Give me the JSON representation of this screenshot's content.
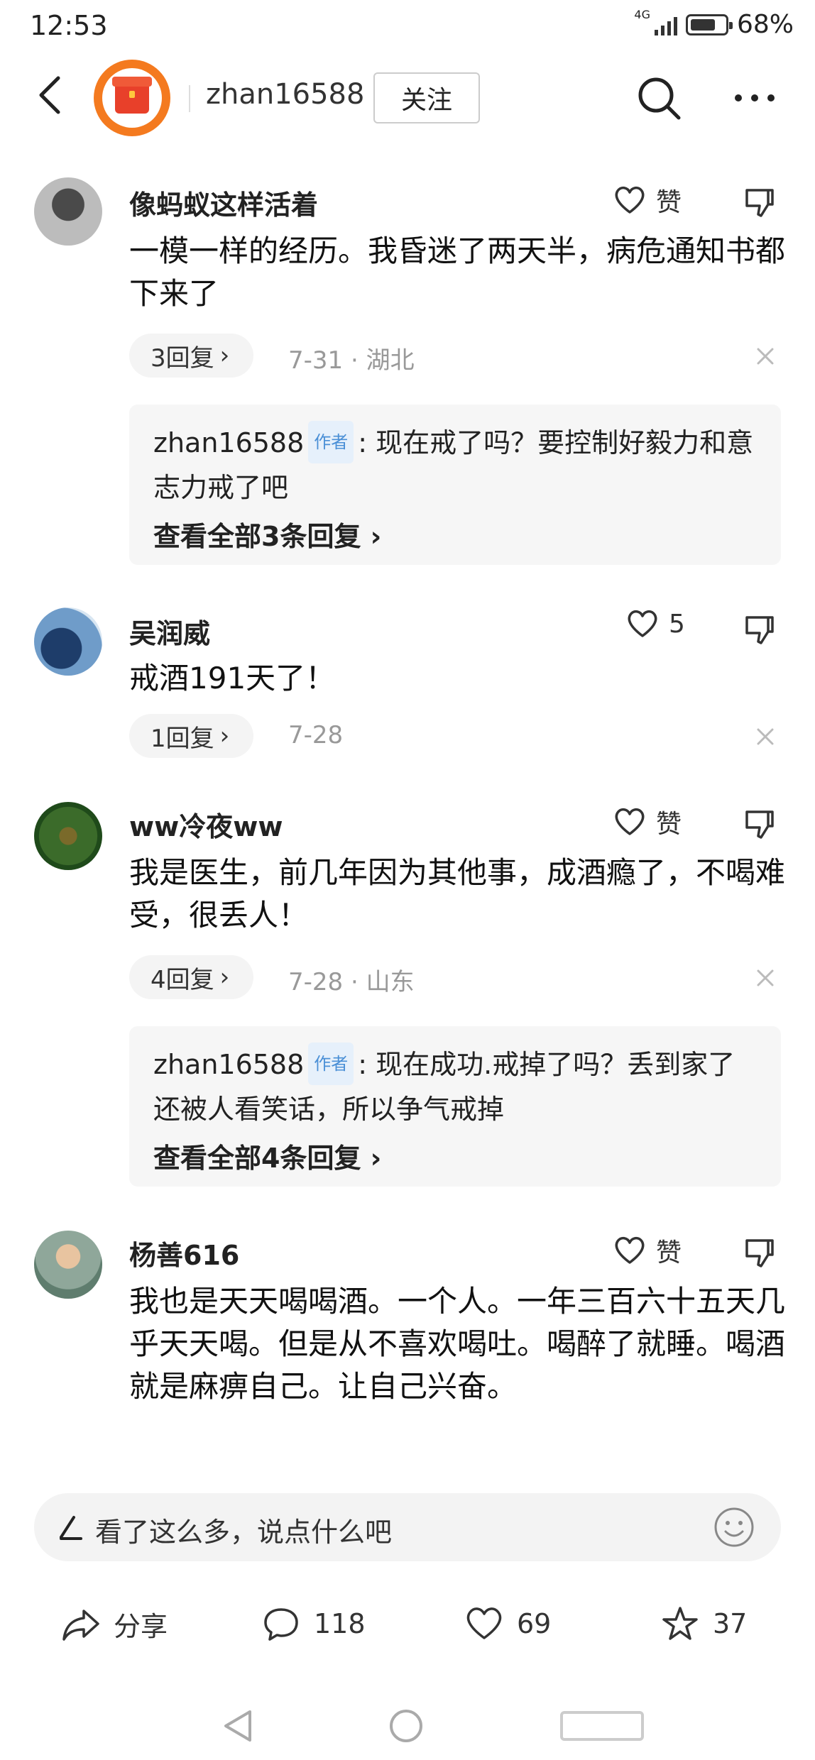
{
  "status_bar": {
    "time": "12:53",
    "network": "4G",
    "battery": "68%"
  },
  "header": {
    "username": "zhan16588",
    "follow_label": "关注"
  },
  "comments": [
    {
      "name": "像蚂蚁这样活着",
      "like_label": "赞",
      "text": "一模一样的经历。我昏迷了两天半，病危通知书都下来了",
      "reply_count": "3回复",
      "meta": "7-31 · 湖北",
      "sub_reply": {
        "author": "zhan16588",
        "author_tag": "作者",
        "text": ": 现在戒了吗？要控制好毅力和意志力戒了吧",
        "view_all": "查看全部3条回复"
      }
    },
    {
      "name": "吴润威",
      "like_label": "5",
      "text": "戒酒191天了！",
      "reply_count": "1回复",
      "meta": "7-28"
    },
    {
      "name": "ww冷夜ww",
      "like_label": "赞",
      "text": "我是医生，前几年因为其他事，成酒瘾了，不喝难受，很丢人！",
      "reply_count": "4回复",
      "meta": "7-28 · 山东",
      "sub_reply": {
        "author": "zhan16588",
        "author_tag": "作者",
        "text": ": 现在成功.戒掉了吗？丢到家了还被人看笑话，所以争气戒掉",
        "view_all": "查看全部4条回复"
      }
    },
    {
      "name": "杨善616",
      "like_label": "赞",
      "text": "我也是天天喝喝酒。一个人。一年三百六十五天几乎天天喝。但是从不喜欢喝吐。喝醉了就睡。喝酒就是麻痹自己。让自己兴奋。"
    }
  ],
  "input": {
    "placeholder": "看了这么多，说点什么吧"
  },
  "actions": {
    "share": "分享",
    "comments": "118",
    "likes": "69",
    "favorites": "37"
  },
  "colors": {
    "accent_orange": "#f47a1f",
    "author_tag_blue": "#4a8fd6"
  }
}
